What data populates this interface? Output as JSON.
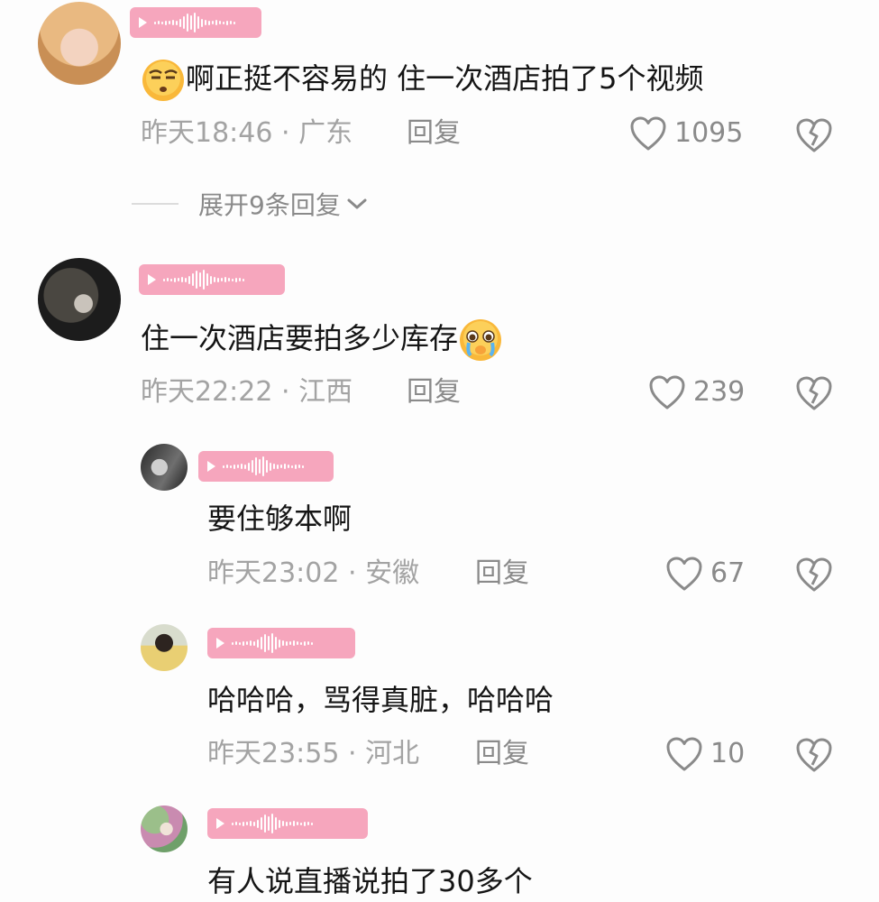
{
  "comments": [
    {
      "content": "啊正挺不容易的 住一次酒店拍了5个视频",
      "emoji": "unamused-face",
      "time": "昨天18:46",
      "location": "广东",
      "reply_label": "回复",
      "likes": "1095",
      "expand_label": "展开9条回复"
    },
    {
      "content": "住一次酒店要拍多少库存",
      "emoji": "pleading-crying-face",
      "time": "昨天22:22",
      "location": "江西",
      "reply_label": "回复",
      "likes": "239",
      "replies": [
        {
          "content": "要住够本啊",
          "time": "昨天23:02",
          "location": "安徽",
          "reply_label": "回复",
          "likes": "67"
        },
        {
          "content": "哈哈哈，骂得真脏，哈哈哈",
          "time": "昨天23:55",
          "location": "河北",
          "reply_label": "回复",
          "likes": "10"
        },
        {
          "content": "有人说直播说拍了30多个"
        }
      ]
    }
  ],
  "separator": "·",
  "colors": {
    "voice_badge": "#f6a6bd",
    "meta_text": "#a3a3a3",
    "action_text": "#8a8a8a"
  },
  "icons": [
    "heart-outline-icon",
    "broken-heart-icon",
    "chevron-down-icon",
    "play-icon"
  ]
}
